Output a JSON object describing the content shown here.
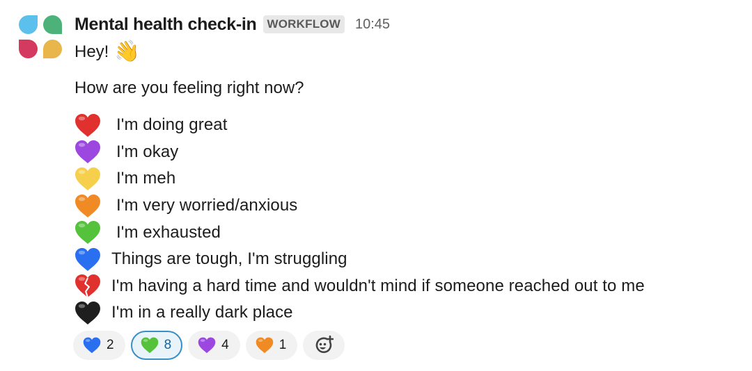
{
  "message": {
    "sender": "Mental health check-in",
    "badge": "WORKFLOW",
    "time": "10:45",
    "avatar": {
      "icon": "workflow-app-icon",
      "colors": [
        "#5bc0eb",
        "#4db27a",
        "#d43a5f",
        "#e8b64a"
      ]
    },
    "greeting": "Hey!",
    "greeting_emoji": "👋",
    "question": "How are you feeling right now?",
    "options": [
      {
        "icon": "red-heart-icon",
        "color": "#e0312e",
        "label": "I'm doing great"
      },
      {
        "icon": "purple-heart-icon",
        "color": "#9b47e0",
        "label": "I'm okay"
      },
      {
        "icon": "yellow-heart-icon",
        "color": "#f6cf4c",
        "label": "I'm meh"
      },
      {
        "icon": "orange-heart-icon",
        "color": "#f08a24",
        "label": "I'm very worried/anxious"
      },
      {
        "icon": "green-heart-icon",
        "color": "#54c23a",
        "label": "I'm exhausted"
      },
      {
        "icon": "blue-heart-icon",
        "color": "#2a6ff0",
        "label": "Things are tough, I'm struggling"
      },
      {
        "icon": "broken-heart-icon",
        "color": "#e0312e",
        "label": "I'm having a hard time and wouldn't mind if someone reached out to me"
      },
      {
        "icon": "black-heart-icon",
        "color": "#1e1e1e",
        "label": "I'm in a really dark place"
      }
    ]
  },
  "reactions": [
    {
      "icon": "blue-heart-icon",
      "color": "#2a6ff0",
      "count": "2",
      "selected": false
    },
    {
      "icon": "green-heart-icon",
      "color": "#54c23a",
      "count": "8",
      "selected": true
    },
    {
      "icon": "purple-heart-icon",
      "color": "#9b47e0",
      "count": "4",
      "selected": false
    },
    {
      "icon": "orange-heart-icon",
      "color": "#f08a24",
      "count": "1",
      "selected": false
    }
  ],
  "add_reaction": {
    "icon": "add-reaction-icon"
  }
}
